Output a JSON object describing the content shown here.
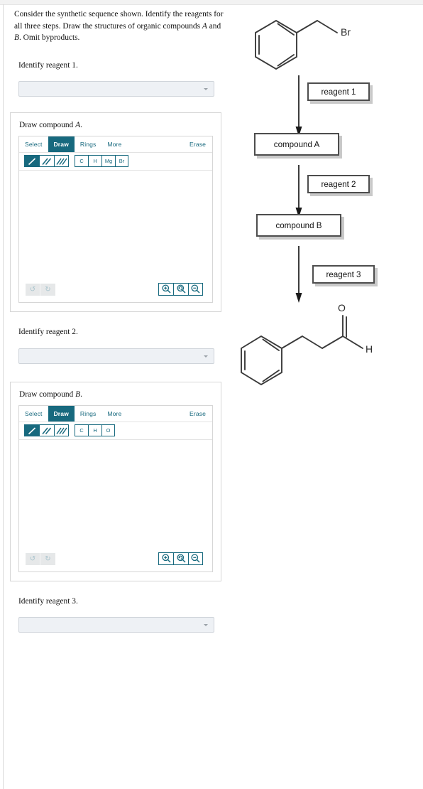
{
  "prompt": {
    "line1": "Consider the synthetic sequence shown. Identify the reagents",
    "line2": "for all three steps. Draw the structures of organic compounds",
    "line3_a": "A",
    "line3_and": " and ",
    "line3_b": "B",
    "line3_tail": ". Omit byproducts."
  },
  "questions": {
    "reagent1_label": "Identify reagent 1.",
    "reagent2_label": "Identify reagent 2.",
    "reagent3_label": "Identify reagent 3.",
    "dropdown_value": "",
    "dropdown_placeholder": "",
    "caret_icon": "chevron-down-icon"
  },
  "editors": [
    {
      "title_prefix": "Draw compound ",
      "title_italic": "A",
      "title_suffix": ".",
      "tabs": [
        {
          "label": "Select",
          "active": false
        },
        {
          "label": "Draw",
          "active": true
        },
        {
          "label": "Rings",
          "active": false
        },
        {
          "label": "More",
          "active": false
        }
      ],
      "erase_label": "Erase",
      "bond_tools": [
        {
          "name": "single-bond-icon",
          "selected": true
        },
        {
          "name": "double-bond-icon",
          "selected": false
        },
        {
          "name": "triple-bond-icon",
          "selected": false
        }
      ],
      "atoms": [
        "C",
        "H",
        "Mg",
        "Br"
      ],
      "history": [
        {
          "name": "undo-icon",
          "glyph": "↺",
          "disabled": true
        },
        {
          "name": "redo-icon",
          "glyph": "↻",
          "disabled": true
        }
      ],
      "zoom_controls": [
        {
          "name": "zoom-in-icon"
        },
        {
          "name": "zoom-reset-icon"
        },
        {
          "name": "zoom-out-icon"
        }
      ]
    },
    {
      "title_prefix": "Draw compound ",
      "title_italic": "B",
      "title_suffix": ".",
      "tabs": [
        {
          "label": "Select",
          "active": false
        },
        {
          "label": "Draw",
          "active": true
        },
        {
          "label": "Rings",
          "active": false
        },
        {
          "label": "More",
          "active": false
        }
      ],
      "erase_label": "Erase",
      "bond_tools": [
        {
          "name": "single-bond-icon",
          "selected": true
        },
        {
          "name": "double-bond-icon",
          "selected": false
        },
        {
          "name": "triple-bond-icon",
          "selected": false
        }
      ],
      "atoms": [
        "C",
        "H",
        "O"
      ],
      "history": [
        {
          "name": "undo-icon",
          "glyph": "↺",
          "disabled": true
        },
        {
          "name": "redo-icon",
          "glyph": "↻",
          "disabled": true
        }
      ],
      "zoom_controls": [
        {
          "name": "zoom-in-icon"
        },
        {
          "name": "zoom-reset-icon"
        },
        {
          "name": "zoom-out-icon"
        }
      ]
    }
  ],
  "scheme": {
    "start_material": {
      "name": "benzyl-bromide",
      "atom_labels": [
        "Br"
      ]
    },
    "steps": [
      {
        "reagent_label": "reagent 1"
      },
      {
        "reagent_label": "reagent 2"
      },
      {
        "reagent_label": "reagent 3"
      }
    ],
    "intermediates": [
      {
        "label": "compound A"
      },
      {
        "label": "compound B"
      }
    ],
    "product": {
      "name": "3-phenylpropanal",
      "atom_labels": [
        "O",
        "H"
      ]
    }
  },
  "colors": {
    "accent_teal": "#17697e",
    "structure_line": "#3a3a3a",
    "box_border": "#4d4d4d",
    "box_shadow": "#c9c9c9",
    "field_bg": "#eef1f5",
    "field_border": "#cfd4da"
  }
}
